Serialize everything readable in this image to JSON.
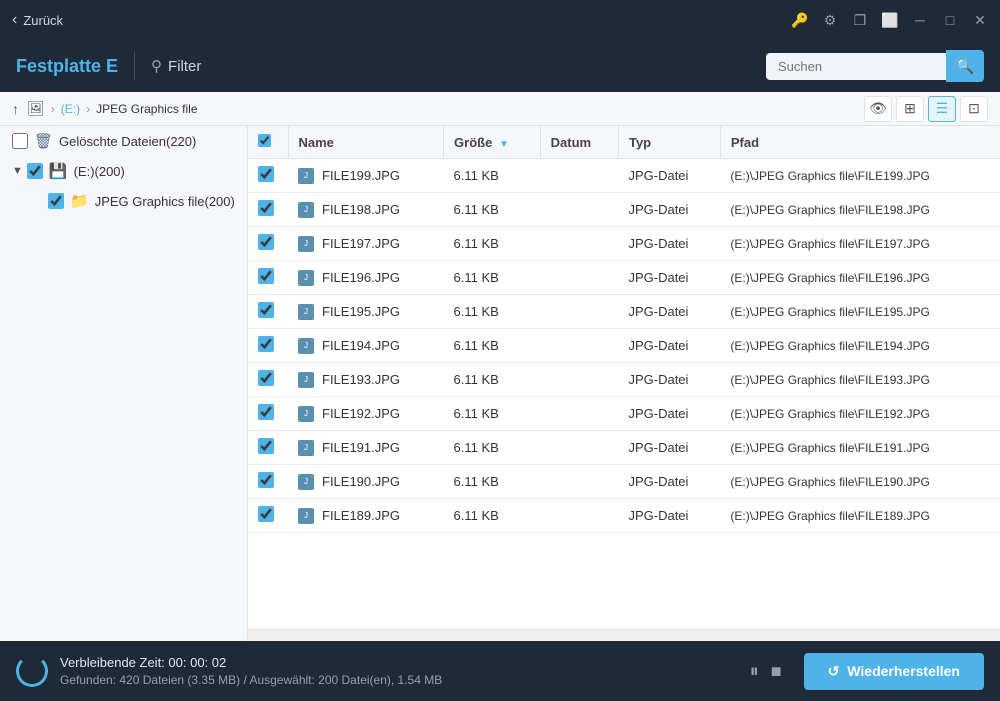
{
  "titleBar": {
    "backLabel": "Zurück",
    "icons": {
      "lock": "🔑",
      "share": "🔗",
      "copy": "❐",
      "restore": "⬜",
      "minimize": "─",
      "maximize": "□",
      "close": "✕"
    }
  },
  "header": {
    "driveTitle": "Festplatte E",
    "filterLabel": "Filter",
    "searchPlaceholder": "Suchen"
  },
  "breadcrumb": {
    "parts": [
      "(E:)",
      "JPEG Graphics file"
    ]
  },
  "sidebar": {
    "items": [
      {
        "id": "deleted",
        "label": "Gelöschte Dateien(220)",
        "indent": 0,
        "hasCheck": true,
        "icon": "trash",
        "checked": false,
        "expanded": false
      },
      {
        "id": "drive-e",
        "label": "(E:)(200)",
        "indent": 0,
        "hasCheck": true,
        "icon": "drive",
        "checked": true,
        "expanded": true
      },
      {
        "id": "jpeg-folder",
        "label": "JPEG Graphics file(200)",
        "indent": 2,
        "hasCheck": true,
        "icon": "folder",
        "checked": true,
        "expanded": false
      }
    ]
  },
  "fileList": {
    "columns": [
      {
        "id": "name",
        "label": "Name",
        "sortable": true
      },
      {
        "id": "size",
        "label": "Größe",
        "sortable": true
      },
      {
        "id": "date",
        "label": "Datum",
        "sortable": false
      },
      {
        "id": "type",
        "label": "Typ",
        "sortable": false
      },
      {
        "id": "path",
        "label": "Pfad",
        "sortable": false
      }
    ],
    "rows": [
      {
        "name": "FILE199.JPG",
        "size": "6.11 KB",
        "date": "",
        "type": "JPG-Datei",
        "path": "(E:)\\JPEG Graphics file\\FILE199.JPG"
      },
      {
        "name": "FILE198.JPG",
        "size": "6.11 KB",
        "date": "",
        "type": "JPG-Datei",
        "path": "(E:)\\JPEG Graphics file\\FILE198.JPG"
      },
      {
        "name": "FILE197.JPG",
        "size": "6.11 KB",
        "date": "",
        "type": "JPG-Datei",
        "path": "(E:)\\JPEG Graphics file\\FILE197.JPG"
      },
      {
        "name": "FILE196.JPG",
        "size": "6.11 KB",
        "date": "",
        "type": "JPG-Datei",
        "path": "(E:)\\JPEG Graphics file\\FILE196.JPG"
      },
      {
        "name": "FILE195.JPG",
        "size": "6.11 KB",
        "date": "",
        "type": "JPG-Datei",
        "path": "(E:)\\JPEG Graphics file\\FILE195.JPG"
      },
      {
        "name": "FILE194.JPG",
        "size": "6.11 KB",
        "date": "",
        "type": "JPG-Datei",
        "path": "(E:)\\JPEG Graphics file\\FILE194.JPG"
      },
      {
        "name": "FILE193.JPG",
        "size": "6.11 KB",
        "date": "",
        "type": "JPG-Datei",
        "path": "(E:)\\JPEG Graphics file\\FILE193.JPG"
      },
      {
        "name": "FILE192.JPG",
        "size": "6.11 KB",
        "date": "",
        "type": "JPG-Datei",
        "path": "(E:)\\JPEG Graphics file\\FILE192.JPG"
      },
      {
        "name": "FILE191.JPG",
        "size": "6.11 KB",
        "date": "",
        "type": "JPG-Datei",
        "path": "(E:)\\JPEG Graphics file\\FILE191.JPG"
      },
      {
        "name": "FILE190.JPG",
        "size": "6.11 KB",
        "date": "",
        "type": "JPG-Datei",
        "path": "(E:)\\JPEG Graphics file\\FILE190.JPG"
      },
      {
        "name": "FILE189.JPG",
        "size": "6.11 KB",
        "date": "",
        "type": "JPG-Datei",
        "path": "(E:)\\JPEG Graphics file\\FILE189.JPG"
      }
    ]
  },
  "statusBar": {
    "timeLabel": "Verbleibende Zeit: 00: 00: 02",
    "detailsLabel": "Gefunden: 420 Dateien (3.35 MB) / Ausgewählt: 200 Datei(en), 1.54 MB",
    "pauseIcon": "⏸",
    "stopIcon": "■",
    "restoreIcon": "↺",
    "restoreLabel": "Wiederherstellen"
  }
}
